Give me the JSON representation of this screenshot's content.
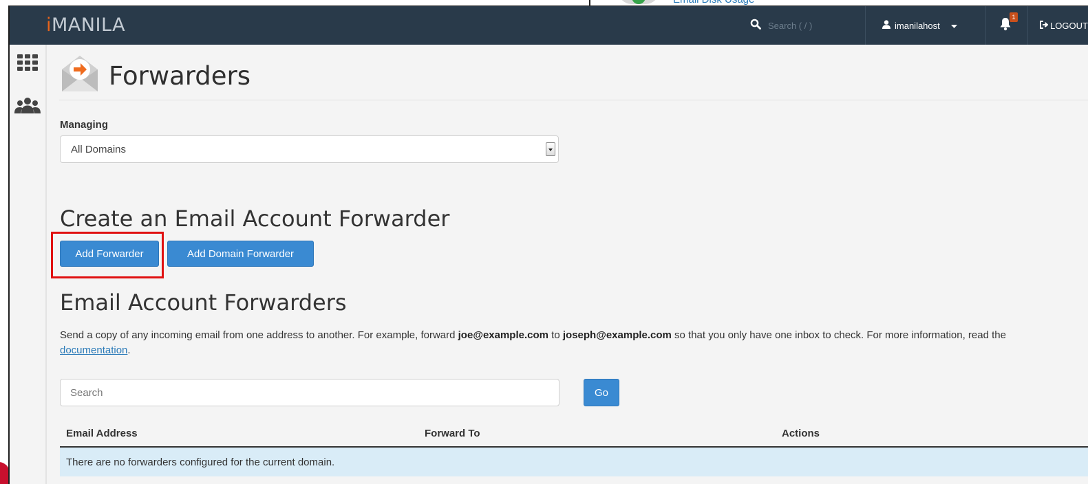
{
  "background_window": {
    "link_text": "Email Disk Usage"
  },
  "topbar": {
    "logo_i": "i",
    "logo_rest": "MANILA",
    "search_placeholder": "Search ( / )",
    "username": "imanilahost",
    "notification_count": "1",
    "logout_label": "LOGOUT"
  },
  "sidebar": {
    "items": [
      {
        "icon": "apps-grid-icon"
      },
      {
        "icon": "users-icon"
      }
    ]
  },
  "page": {
    "title": "Forwarders",
    "managing_label": "Managing",
    "managing_value": "All Domains",
    "create_heading": "Create an Email Account Forwarder",
    "add_forwarder_label": "Add Forwarder",
    "add_domain_forwarder_label": "Add Domain Forwarder",
    "list_heading": "Email Account Forwarders",
    "description": {
      "part1": "Send a copy of any incoming email from one address to another. For example, forward ",
      "example_from": "joe@example.com",
      "part2": " to ",
      "example_to": "joseph@example.com",
      "part3": " so that you only have one inbox to check. For more information, read the ",
      "doc_link": "documentation",
      "part4": "."
    },
    "search_placeholder": "Search",
    "go_label": "Go",
    "table": {
      "columns": [
        "Email Address",
        "Forward To",
        "Actions"
      ],
      "empty_message": "There are no forwarders configured for the current domain."
    }
  },
  "colors": {
    "topbar": "#293a4a",
    "accent_orange": "#e8641b",
    "primary_button": "#3a8ad2",
    "highlight_box": "#e01010",
    "empty_row": "#d9ecf7"
  }
}
